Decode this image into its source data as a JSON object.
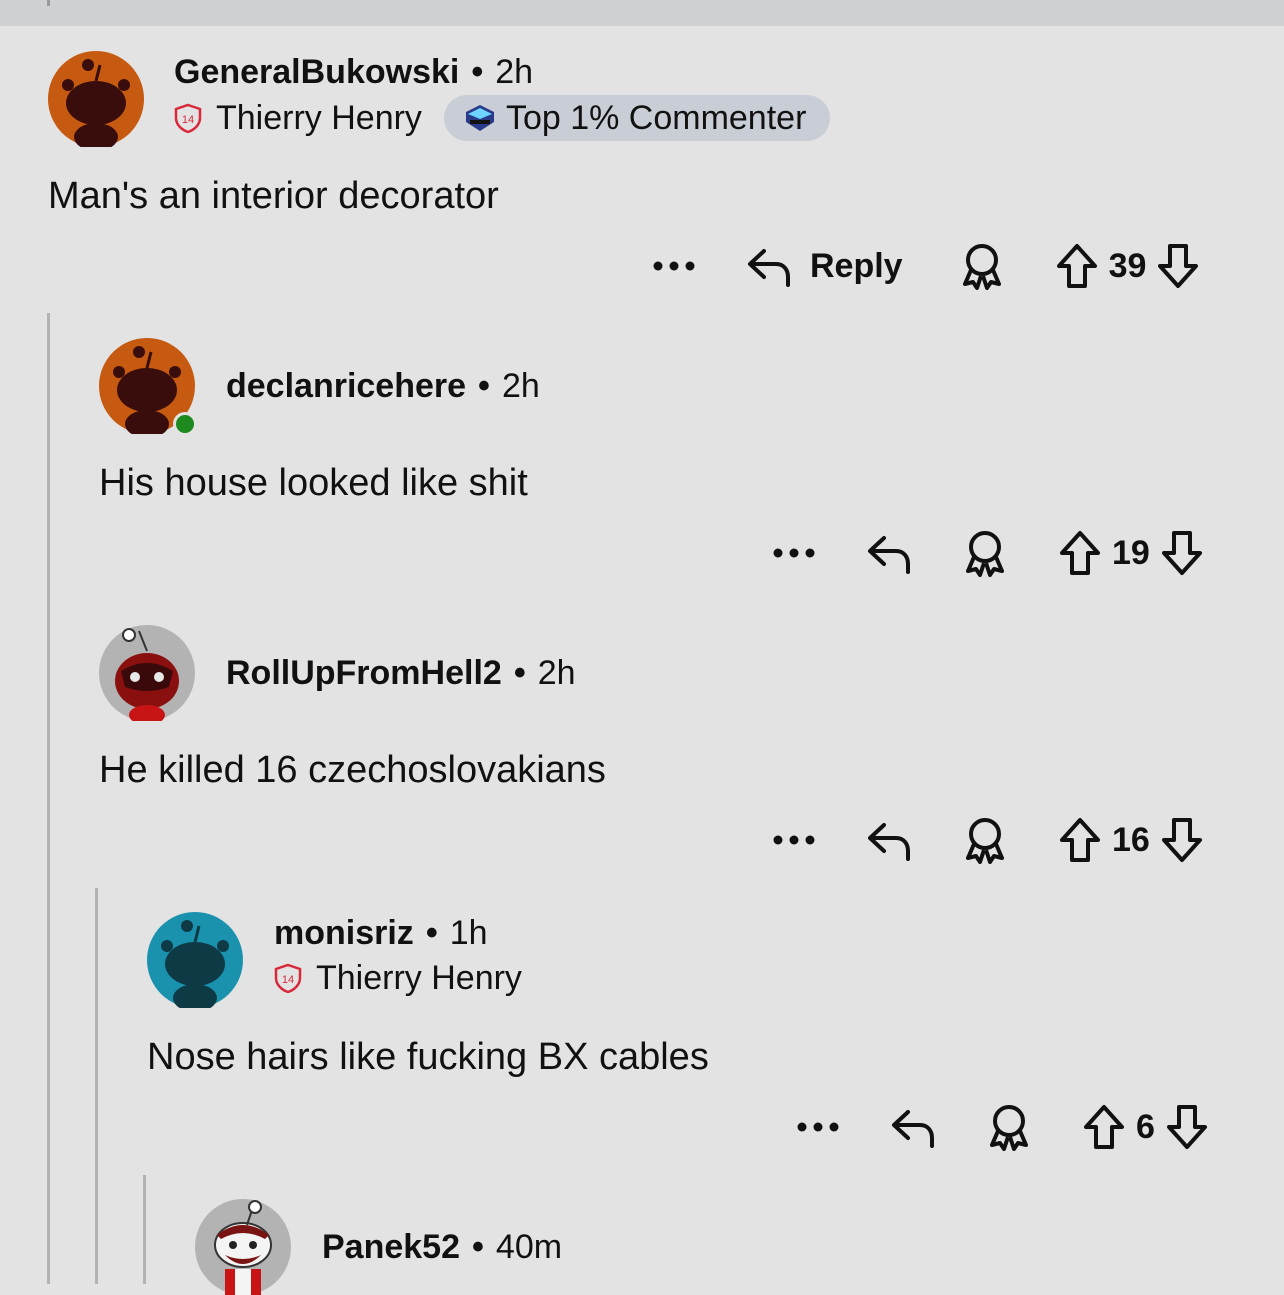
{
  "comments": [
    {
      "username": "GeneralBukowski",
      "time": "2h",
      "flair": "Thierry Henry",
      "flair_number": "14",
      "badge": "Top 1% Commenter",
      "body": "Man's an interior decorator",
      "votes": "39",
      "reply_label": "Reply",
      "avatar_color": "#c65a10"
    },
    {
      "username": "declanricehere",
      "time": "2h",
      "body": "His house looked like shit",
      "votes": "19",
      "avatar_color": "#c65a10",
      "online": true
    },
    {
      "username": "RollUpFromHell2",
      "time": "2h",
      "body": "He killed 16 czechoslovakians",
      "votes": "16",
      "avatar_color": "#b3b3b3"
    },
    {
      "username": "monisriz",
      "time": "1h",
      "flair": "Thierry Henry",
      "flair_number": "14",
      "body": "Nose hairs like fucking BX cables",
      "votes": "6",
      "avatar_color": "#1a92ad"
    },
    {
      "username": "Panek52",
      "time": "40m",
      "avatar_color": "#b3b3b3"
    }
  ],
  "separator": "•",
  "more_label": "•••",
  "accent_colors": {
    "shield": "#d8283a",
    "online": "#1e8a1e",
    "badge_bg": "#c9ced6"
  },
  "icons": [
    "more-icon",
    "reply-icon",
    "award-icon",
    "upvote-icon",
    "downvote-icon",
    "shield-icon",
    "top-commenter-icon"
  ]
}
